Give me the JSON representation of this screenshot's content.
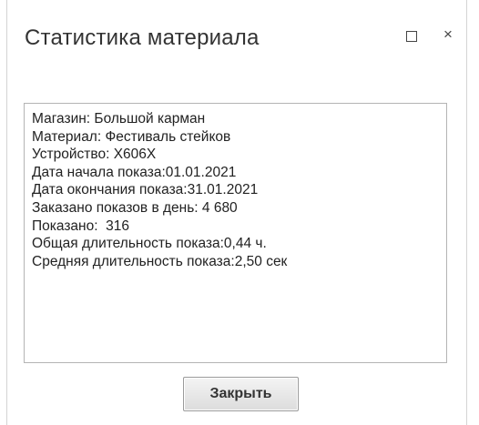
{
  "window": {
    "title": "Статистика материала",
    "maximize_icon": "square-icon",
    "close_glyph": "×"
  },
  "info": {
    "lines": [
      "Магазин: Большой карман",
      "Материал: Фестиваль стейков",
      "Устройство: Х606Х",
      "Дата начала показа:01.01.2021",
      "Дата окончания показа:31.01.2021",
      "Заказано показов в день: 4 680",
      "Показано:  316",
      "Общая длительность показа:0,44 ч.",
      "Средняя длительность показа:2,50 сек"
    ]
  },
  "footer": {
    "close_label": "Закрыть"
  }
}
